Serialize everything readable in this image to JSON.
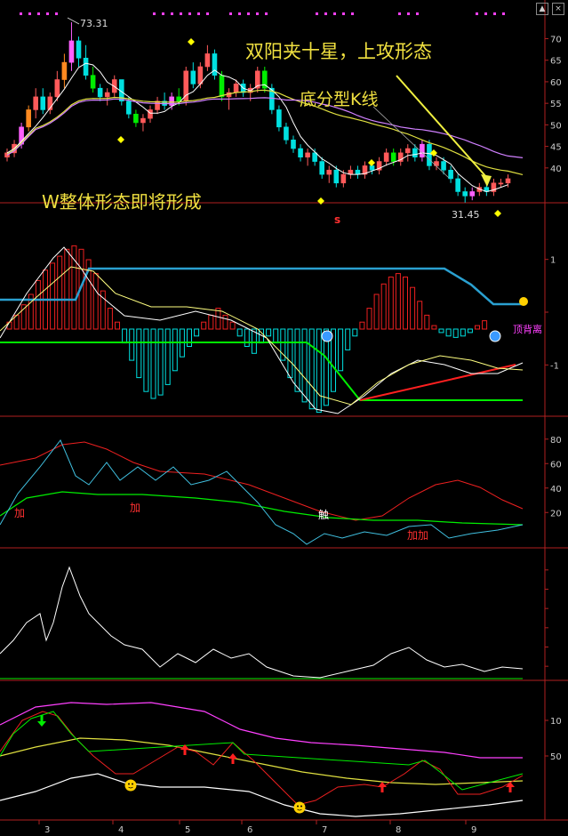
{
  "controls": {
    "up_glyph": "▲",
    "close_glyph": "×"
  },
  "annotations": {
    "headline": "双阳夹十星，上攻形态",
    "bottom_fractal": "底分型K线",
    "w_pattern": "W整体形态即将形成",
    "high_label": "73.31",
    "low_label": "31.45",
    "s_mark": "s",
    "macd_label": "顶背离",
    "kd_add_1": "加",
    "kd_add_2": "加",
    "kd_touch": "触",
    "kd_add_3": "加加"
  },
  "colors": {
    "up": "#ff5a5a",
    "down": "#00e0e0",
    "ma5": "#ffffff",
    "ma_yellow": "#e0e040",
    "ma_violet": "#d080ff",
    "green": "#00ee00",
    "blue": "#2aa0d0",
    "red": "#ee2020",
    "axis": "#b02020"
  },
  "chart_data": [
    {
      "type": "candlestick",
      "panel": "price",
      "x_ticks": [
        "3",
        "4",
        "5",
        "6",
        "7",
        "8",
        "9"
      ],
      "y_ticks": [
        "70",
        "65",
        "60",
        "55",
        "50",
        "45",
        "40"
      ],
      "ylim": [
        31,
        76
      ],
      "candles": [
        [
          42,
          44,
          41,
          43
        ],
        [
          43,
          46,
          42,
          45
        ],
        [
          45,
          50,
          44,
          49
        ],
        [
          49,
          54,
          48,
          53
        ],
        [
          53,
          58,
          51,
          56
        ],
        [
          56,
          58,
          52,
          53
        ],
        [
          53,
          57,
          52,
          56
        ],
        [
          56,
          62,
          55,
          60
        ],
        [
          60,
          66,
          58,
          64
        ],
        [
          64,
          73.31,
          62,
          69
        ],
        [
          69,
          70,
          63,
          65
        ],
        [
          65,
          68,
          60,
          61
        ],
        [
          61,
          63,
          57,
          58
        ],
        [
          58,
          59,
          55,
          56
        ],
        [
          56,
          58,
          54,
          57
        ],
        [
          57,
          61,
          56,
          60
        ],
        [
          60,
          60,
          54,
          55
        ],
        [
          55,
          56,
          51,
          52
        ],
        [
          52,
          53,
          49,
          50
        ],
        [
          50,
          52,
          48,
          51
        ],
        [
          51,
          54,
          50,
          53
        ],
        [
          53,
          56,
          52,
          55
        ],
        [
          55,
          57,
          53,
          54
        ],
        [
          54,
          57,
          53,
          56
        ],
        [
          56,
          58,
          54,
          55
        ],
        [
          55,
          63,
          54,
          62
        ],
        [
          62,
          64,
          58,
          59
        ],
        [
          59,
          64,
          58,
          63
        ],
        [
          63,
          68,
          62,
          66
        ],
        [
          66,
          67,
          60,
          61
        ],
        [
          61,
          62,
          55,
          56
        ],
        [
          56,
          58,
          53,
          57
        ],
        [
          57,
          60,
          56,
          59
        ],
        [
          59,
          60,
          56,
          57
        ],
        [
          57,
          59,
          55,
          58
        ],
        [
          58,
          63,
          57,
          62
        ],
        [
          62,
          63,
          57,
          58
        ],
        [
          58,
          59,
          52,
          53
        ],
        [
          53,
          54,
          48,
          49
        ],
        [
          49,
          50,
          45,
          46
        ],
        [
          46,
          47,
          43,
          44
        ],
        [
          44,
          45,
          41,
          42
        ],
        [
          42,
          44,
          40,
          43
        ],
        [
          43,
          44,
          40,
          41
        ],
        [
          41,
          42,
          37,
          38
        ],
        [
          38,
          40,
          36,
          39
        ],
        [
          39,
          40,
          35,
          36
        ],
        [
          36,
          39,
          35,
          38
        ],
        [
          38,
          40,
          37,
          39
        ],
        [
          39,
          40,
          37,
          38
        ],
        [
          38,
          41,
          37,
          40
        ],
        [
          40,
          41,
          38,
          39
        ],
        [
          39,
          42,
          38,
          41
        ],
        [
          41,
          44,
          40,
          43
        ],
        [
          43,
          44,
          40,
          41
        ],
        [
          41,
          44,
          40,
          43
        ],
        [
          43,
          45,
          41,
          44
        ],
        [
          44,
          45,
          41,
          42
        ],
        [
          42,
          46,
          41,
          45
        ],
        [
          45,
          46,
          39,
          40
        ],
        [
          40,
          42,
          39,
          41
        ],
        [
          41,
          42,
          38,
          39
        ],
        [
          39,
          40,
          36,
          37
        ],
        [
          37,
          38,
          33,
          34
        ],
        [
          34,
          35,
          31.45,
          33
        ],
        [
          33,
          35,
          32,
          34
        ],
        [
          34,
          36,
          33,
          35
        ],
        [
          35,
          36,
          33,
          34
        ],
        [
          34,
          37,
          33,
          36
        ],
        [
          36,
          37,
          35,
          36
        ],
        [
          36,
          38,
          35,
          37
        ]
      ]
    },
    {
      "type": "bar",
      "panel": "macd",
      "y_ticks": [
        "1",
        "",
        "-1"
      ],
      "label": "顶背离",
      "histogram": [
        0.1,
        0.2,
        0.35,
        0.5,
        0.7,
        0.85,
        0.95,
        1.05,
        1.15,
        1.2,
        1.15,
        1.0,
        0.8,
        0.55,
        0.3,
        0.1,
        -0.2,
        -0.45,
        -0.7,
        -0.9,
        -1.0,
        -0.95,
        -0.8,
        -0.6,
        -0.4,
        -0.25,
        -0.1,
        0.1,
        0.2,
        0.3,
        0.2,
        0.1,
        -0.1,
        -0.25,
        -0.35,
        -0.2,
        -0.1,
        -0.2,
        -0.45,
        -0.7,
        -0.9,
        -1.05,
        -1.15,
        -1.2,
        -1.1,
        -0.9,
        -0.6,
        -0.3,
        -0.1,
        0.1,
        0.3,
        0.5,
        0.65,
        0.75,
        0.8,
        0.75,
        0.6,
        0.4,
        0.2,
        0.05,
        -0.05,
        -0.1,
        -0.12,
        -0.1,
        -0.05,
        0.05,
        0.12
      ]
    },
    {
      "type": "line",
      "panel": "kd",
      "y_ticks": [
        "80",
        "60",
        "40",
        "20"
      ],
      "ylim": [
        0,
        90
      ],
      "labels": [
        "加",
        "加",
        "触",
        "加加"
      ]
    },
    {
      "type": "line",
      "panel": "volatility",
      "y_ticks": []
    },
    {
      "type": "line",
      "panel": "bands",
      "y_ticks": [
        "10",
        "50"
      ]
    }
  ]
}
